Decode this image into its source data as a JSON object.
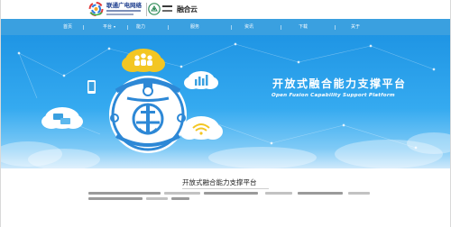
{
  "header": {
    "logo_guangdian": {
      "name": "联通广电网络",
      "icon": "guangdian-logo-icon"
    },
    "logo_lab": {
      "icon": "lab-logo-icon"
    },
    "logo_yunshe": {
      "text": "融合云",
      "icon": "yunshe-logo-icon"
    }
  },
  "nav": {
    "items": [
      {
        "label": "首页"
      },
      {
        "label": "平台",
        "has_dropdown": true
      },
      {
        "label": "能力"
      },
      {
        "label": "服务"
      },
      {
        "label": "资讯"
      },
      {
        "label": "下载"
      },
      {
        "label": "关于"
      }
    ],
    "background": "#3aa0e0"
  },
  "hero": {
    "title": "开放式融合能力支撑平台",
    "subtitle": "Open Fusion Capability Support Platform",
    "icons": [
      "people-cloud-icon",
      "chart-cloud-icon",
      "phone-icon",
      "chat-cloud-icon",
      "wifi-cloud-icon",
      "seal-logo-icon"
    ],
    "colors": {
      "sky_top": "#1f95e4",
      "sky_bottom": "#cfe9fb",
      "cloud_yellow": "#f3c623"
    }
  },
  "section": {
    "title": "开放式融合能力支撑平台"
  }
}
